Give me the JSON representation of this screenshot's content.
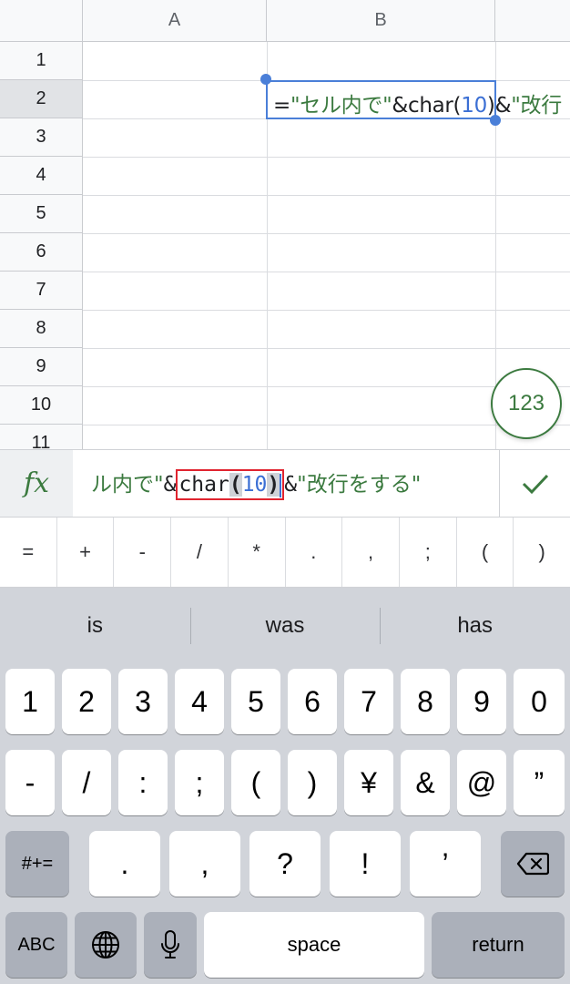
{
  "sheet": {
    "columns": [
      "A",
      "B"
    ],
    "rows": [
      "1",
      "2",
      "3",
      "4",
      "5",
      "6",
      "7",
      "8",
      "9",
      "10",
      "11"
    ],
    "cell_b2": {
      "eq": "=",
      "str1": "\"セル内で\"",
      "amp1": "&",
      "func": "char(",
      "arg": "10",
      "close": ")",
      "amp2": "&",
      "str2": "\"改行"
    },
    "fab_label": "123"
  },
  "formula_bar": {
    "fx_label": "fx",
    "str1": "ル内で\"",
    "amp1": "&",
    "func": "char",
    "open": "(",
    "arg": "10",
    "close": ")",
    "amp2": "&",
    "str2": "\"改行をする\""
  },
  "symbols": [
    "=",
    "+",
    "-",
    "/",
    "*",
    ".",
    ",",
    ";",
    "(",
    ")"
  ],
  "keyboard": {
    "suggestions": [
      "is",
      "was",
      "has"
    ],
    "row1": [
      "1",
      "2",
      "3",
      "4",
      "5",
      "6",
      "7",
      "8",
      "9",
      "0"
    ],
    "row2": [
      "-",
      "/",
      ":",
      ";",
      "(",
      ")",
      "¥",
      "&",
      "@",
      "”"
    ],
    "row3_left": "#+=",
    "row3": [
      ".",
      ",",
      "?",
      "!",
      "’"
    ],
    "abc": "ABC",
    "space": "space",
    "return": "return"
  },
  "colors": {
    "accent_green": "#3b7a3f",
    "selection_blue": "#4a7fd8",
    "highlight_red": "#e0242f"
  }
}
